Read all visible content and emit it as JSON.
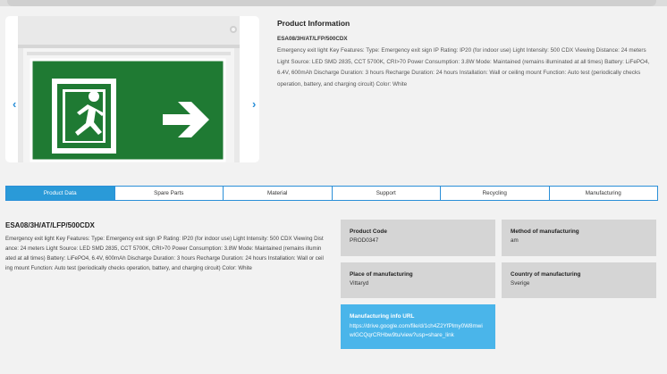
{
  "carousel": {
    "prev_icon": "chevron-left-icon",
    "next_icon": "chevron-right-icon",
    "slide_count": 2,
    "active_slide": 1,
    "accent_color": "#2a8fd8",
    "sign_color": "#1f7a33"
  },
  "product_info": {
    "title": "Product Information",
    "code": "ESA08/3H/AT/LFP/500CDX",
    "description": "Emergency exit light Key Features: Type: Emergency exit sign IP Rating: IP20 (for indoor use) Light Intensity: 500 CDX Viewing Distance: 24 meters Light Source: LED SMD 2835, CCT 5700K, CRI>70 Power Consumption: 3.8W Mode: Maintained (remains illuminated at all times) Battery: LiFePO4, 6.4V, 600mAh Discharge Duration: 3 hours Recharge Duration: 24 hours Installation: Wall or ceiling mount Function: Auto test (periodically checks operation, battery, and charging circuit) Color: White"
  },
  "tabs": [
    {
      "label": "Product Data",
      "active": true
    },
    {
      "label": "Spare Parts",
      "active": false
    },
    {
      "label": "Material",
      "active": false
    },
    {
      "label": "Support",
      "active": false
    },
    {
      "label": "Recycling",
      "active": false
    },
    {
      "label": "Manufacturing",
      "active": false
    }
  ],
  "product_data": {
    "code": "ESA08/3H/AT/LFP/500CDX",
    "description": "Emergency exit light Key Features: Type: Emergency exit sign IP Rating: IP20 (for indoor use) Light Intensity: 500 CDX Viewing Distance: 24 meters Light Source: LED SMD 2835, CCT 5700K, CRI>70 Power Consumption: 3.8W Mode: Maintained (remains illuminated at all times) Battery: LiFePO4, 6.4V, 600mAh Discharge Duration: 3 hours Recharge Duration: 24 hours Installation: Wall or ceiling mount Function: Auto test (periodically checks operation, battery, and charging circuit) Color: White"
  },
  "cards": {
    "product_code": {
      "label": "Product Code",
      "value": "PROD0347"
    },
    "method": {
      "label": "Method of manufacturing",
      "value": "am"
    },
    "place": {
      "label": "Place of manufacturing",
      "value": "Vittaryd"
    },
    "country": {
      "label": "Country of manufacturing",
      "value": "Sverige"
    },
    "url": {
      "label": "Manufacturing info URL",
      "value": "https://drive.google.com/file/d/1ch4Z2YfPlmy0W8mwiwlGCQqrCRHbw9tu/view?usp=share_link"
    }
  }
}
